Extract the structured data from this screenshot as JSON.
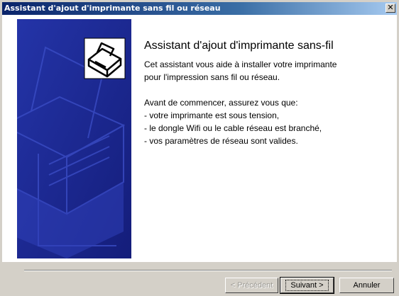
{
  "window": {
    "title": "Assistant d'ajout d'imprimante sans fil ou réseau",
    "close_glyph": "✕"
  },
  "wizard": {
    "heading": "Assistant d'ajout d'imprimante sans-fil",
    "intro_lines": [
      "Cet assistant vous aide à installer votre imprimante",
      "pour l'impression sans fil ou réseau."
    ],
    "checklist_intro": "Avant de commencer, assurez vous que:",
    "checklist": [
      "- votre imprimante est sous tension,",
      "- le dongle Wifi ou le cable réseau est branché,",
      "- vos paramètres de réseau sont valides."
    ],
    "side_image_icon": "printer-icon"
  },
  "buttons": {
    "previous": "< Précédent",
    "next": "Suivant >",
    "cancel": "Annuler"
  },
  "colors": {
    "title_bar": "#0a246a",
    "side_panel": "#1c2896",
    "dialog_face": "#d4d0c8"
  }
}
